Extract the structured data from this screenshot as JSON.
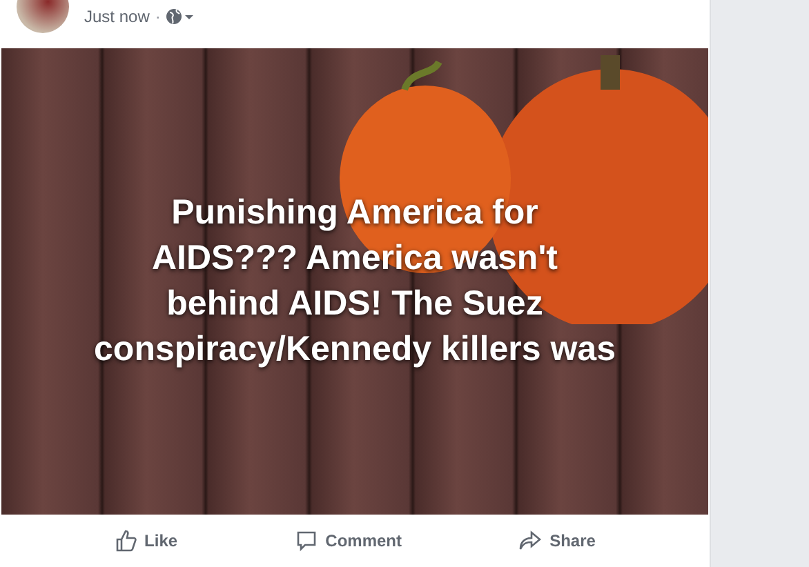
{
  "post": {
    "time": "Just now",
    "separator": "·",
    "text_lines": [
      "Punishing America for",
      "AIDS??? America wasn't",
      "behind AIDS! The Suez",
      "conspiracy/Kennedy killers was"
    ],
    "actions": [
      {
        "label": "Like",
        "kind": "like"
      },
      {
        "label": "Comment",
        "kind": "comment"
      },
      {
        "label": "Share",
        "kind": "share"
      }
    ]
  }
}
